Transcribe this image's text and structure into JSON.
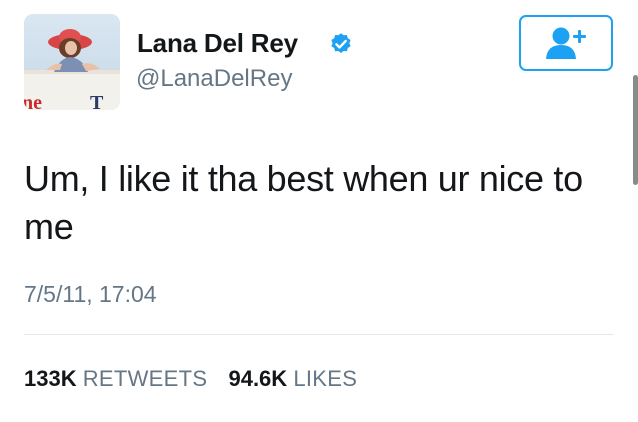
{
  "author": {
    "display_name": "Lana Del Rey",
    "handle": "@LanaDelRey",
    "verified": true,
    "avatar_icon": "profile-photo"
  },
  "follow_button": {
    "icon": "add-user-icon"
  },
  "tweet": {
    "text": "Um, I like it tha best when ur nice to me",
    "timestamp": "7/5/11, 17:04"
  },
  "stats": {
    "retweets_count": "133K",
    "retweets_label": "RETWEETS",
    "likes_count": "94.6K",
    "likes_label": "LIKES"
  },
  "colors": {
    "accent": "#1da1f2",
    "text_primary": "#14171a",
    "text_secondary": "#657786",
    "divider": "#e1e8ed"
  }
}
